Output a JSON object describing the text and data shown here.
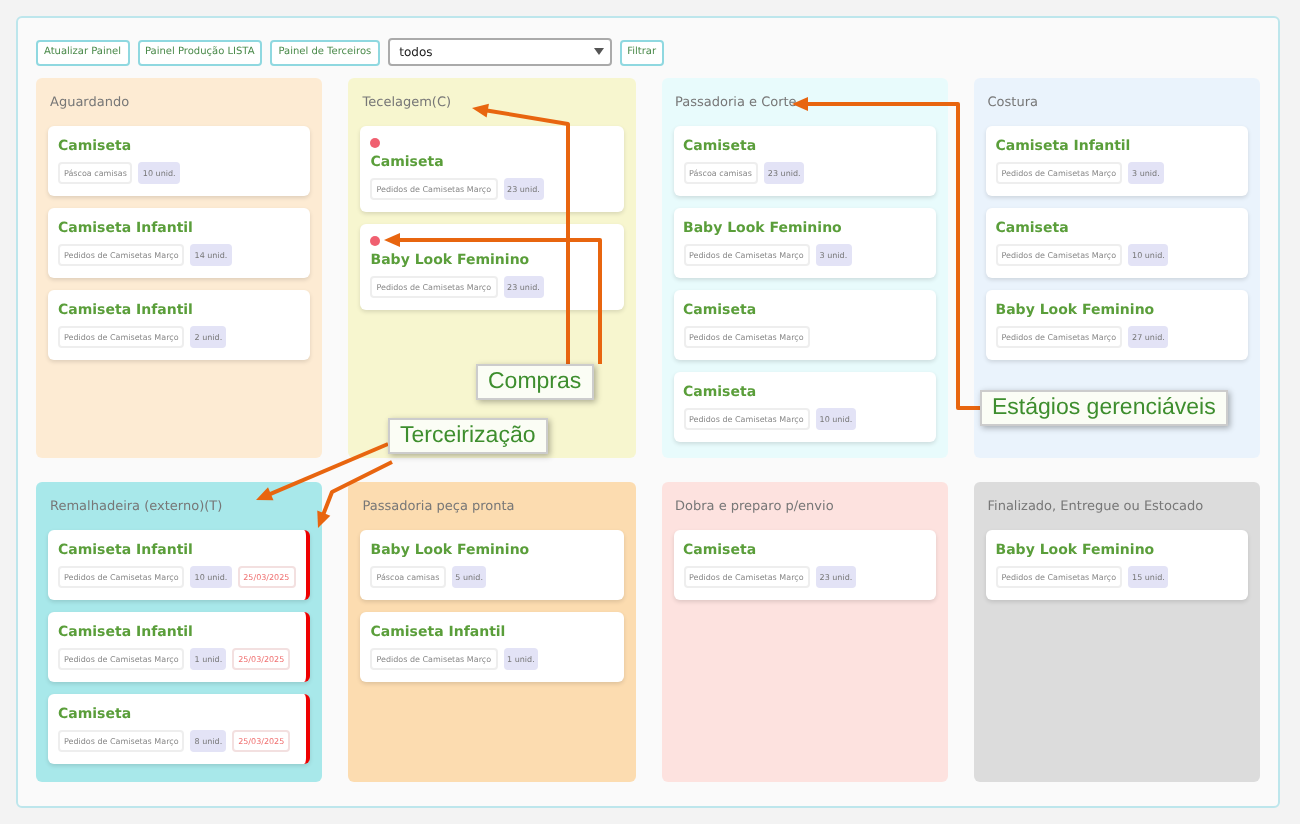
{
  "toolbar": {
    "buttons": [
      "Atualizar Painel",
      "Painel Produção LISTA",
      "Painel de Terceiros"
    ],
    "select": {
      "value": "todos"
    },
    "filter_button": "Filtrar"
  },
  "columns": [
    {
      "title": "Aguardando",
      "color": "#fdebd3",
      "cards": [
        {
          "title": "Camiseta",
          "order": "Páscoa camisas",
          "qty": "10 unid.",
          "flag": false,
          "late": false
        },
        {
          "title": "Camiseta Infantil",
          "order": "Pedidos de Camisetas Março",
          "qty": "14 unid.",
          "flag": false,
          "late": false
        },
        {
          "title": "Camiseta Infantil",
          "order": "Pedidos de Camisetas Março",
          "qty": "2 unid.",
          "flag": false,
          "late": false
        }
      ]
    },
    {
      "title": "Tecelagem(C)",
      "color": "#f7f6cf",
      "cards": [
        {
          "title": "Camiseta",
          "order": "Pedidos de Camisetas Março",
          "qty": "23 unid.",
          "flag": true,
          "late": false
        },
        {
          "title": "Baby Look Feminino",
          "order": "Pedidos de Camisetas Março",
          "qty": "23 unid.",
          "flag": true,
          "late": false
        }
      ]
    },
    {
      "title": "Passadoria e Corte",
      "color": "#e8fbfc",
      "cards": [
        {
          "title": "Camiseta",
          "order": "Páscoa camisas",
          "qty": "23 unid.",
          "flag": false,
          "late": false
        },
        {
          "title": "Baby Look Feminino",
          "order": "Pedidos de Camisetas Março",
          "qty": "3 unid.",
          "flag": false,
          "late": false
        },
        {
          "title": "Camiseta",
          "order": "Pedidos de Camisetas Março",
          "flag": false,
          "late": false
        },
        {
          "title": "Camiseta",
          "order": "Pedidos de Camisetas Março",
          "qty": "10 unid.",
          "flag": false,
          "late": false
        }
      ]
    },
    {
      "title": "Costura",
      "color": "#eaf3fc",
      "cards": [
        {
          "title": "Camiseta Infantil",
          "order": "Pedidos de Camisetas Março",
          "qty": "3 unid.",
          "flag": false,
          "late": false
        },
        {
          "title": "Camiseta",
          "order": "Pedidos de Camisetas Março",
          "qty": "10 unid.",
          "flag": false,
          "late": false
        },
        {
          "title": "Baby Look Feminino",
          "order": "Pedidos de Camisetas Março",
          "qty": "27 unid.",
          "flag": false,
          "late": false
        }
      ]
    },
    {
      "title": "Remalhadeira (externo)(T)",
      "color": "#a8e8ea",
      "cards": [
        {
          "title": "Camiseta Infantil",
          "order": "Pedidos de Camisetas Março",
          "qty": "10 unid.",
          "date": "25/03/2025",
          "flag": false,
          "late": true
        },
        {
          "title": "Camiseta Infantil",
          "order": "Pedidos de Camisetas Março",
          "qty": "1 unid.",
          "date": "25/03/2025",
          "flag": false,
          "late": true
        },
        {
          "title": "Camiseta",
          "order": "Pedidos de Camisetas Março",
          "qty": "8 unid.",
          "date": "25/03/2025",
          "flag": false,
          "late": true
        }
      ]
    },
    {
      "title": "Passadoria peça pronta",
      "color": "#fcdcb0",
      "cards": [
        {
          "title": "Baby Look Feminino",
          "order": "Páscoa camisas",
          "qty": "5 unid.",
          "flag": false,
          "late": false
        },
        {
          "title": "Camiseta Infantil",
          "order": "Pedidos de Camisetas Março",
          "qty": "1 unid.",
          "flag": false,
          "late": false
        }
      ]
    },
    {
      "title": "Dobra e preparo p/envio",
      "color": "#fde2df",
      "cards": [
        {
          "title": "Camiseta",
          "order": "Pedidos de Camisetas Março",
          "qty": "23 unid.",
          "flag": false,
          "late": false
        }
      ]
    },
    {
      "title": "Finalizado, Entregue ou Estocado",
      "color": "#dcdcdc",
      "cards": [
        {
          "title": "Baby Look Feminino",
          "order": "Pedidos de Camisetas Março",
          "qty": "15 unid.",
          "flag": false,
          "late": false
        }
      ]
    }
  ],
  "annotations": [
    "Compras",
    "Estágios gerenciáveis",
    "Terceirização"
  ]
}
